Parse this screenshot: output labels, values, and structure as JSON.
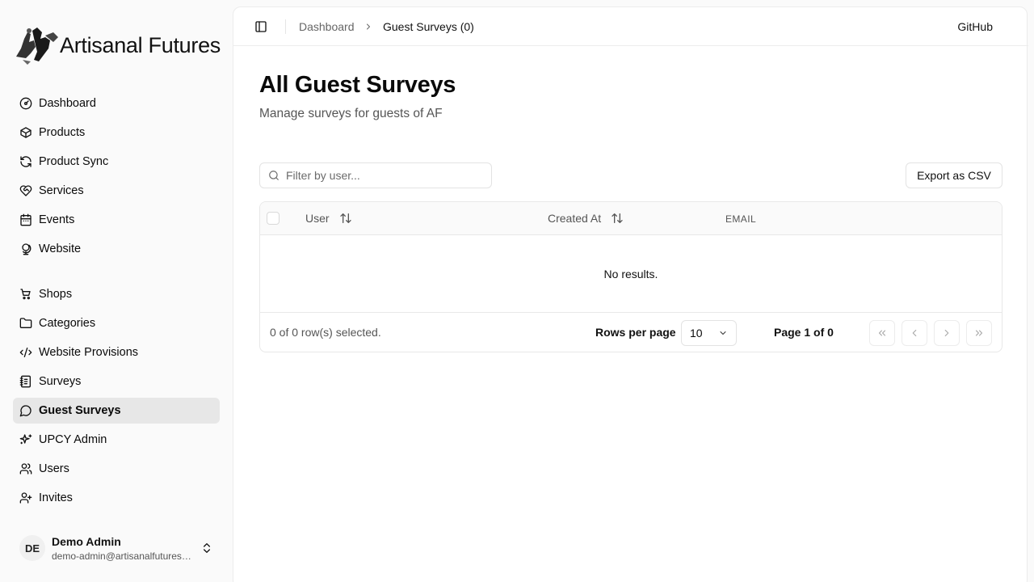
{
  "app": {
    "name": "Artisanal Futures"
  },
  "sidebar": {
    "items": [
      {
        "label": "Dashboard",
        "icon": "gauge-icon"
      },
      {
        "label": "Products",
        "icon": "package-icon"
      },
      {
        "label": "Product Sync",
        "icon": "refresh-icon"
      },
      {
        "label": "Services",
        "icon": "heart-handshake-icon"
      },
      {
        "label": "Events",
        "icon": "calendar-icon"
      },
      {
        "label": "Website",
        "icon": "globe-stand-icon"
      },
      {
        "label": "Shops",
        "icon": "store-icon"
      },
      {
        "label": "Categories",
        "icon": "folder-icon"
      },
      {
        "label": "Website Provisions",
        "icon": "code-icon"
      },
      {
        "label": "Surveys",
        "icon": "notebook-icon"
      },
      {
        "label": "Guest Surveys",
        "icon": "message-circle-icon",
        "active": true
      },
      {
        "label": "UPCY Admin",
        "icon": "sparkles-icon"
      },
      {
        "label": "Users",
        "icon": "users-icon"
      },
      {
        "label": "Invites",
        "icon": "user-plus-icon"
      }
    ]
  },
  "user": {
    "initials": "DE",
    "name": "Demo Admin",
    "email": "demo-admin@artisanalfutures.org"
  },
  "header": {
    "breadcrumb": [
      "Dashboard",
      "Guest Surveys (0)"
    ],
    "github_label": "GitHub"
  },
  "page": {
    "title": "All Guest Surveys",
    "subtitle": "Manage surveys for guests of AF"
  },
  "toolbar": {
    "filter_placeholder": "Filter by user...",
    "export_label": "Export as CSV"
  },
  "table": {
    "columns": [
      "User",
      "Created At",
      "EMAIL"
    ],
    "empty_text": "No results.",
    "selected_text": "0 of 0 row(s) selected.",
    "rows_per_page_label": "Rows per page",
    "rows_per_page_value": "10",
    "page_info": "Page 1 of 0"
  },
  "colors": {
    "active_bg": "#e7e7e7",
    "border": "#e8e8e8"
  }
}
